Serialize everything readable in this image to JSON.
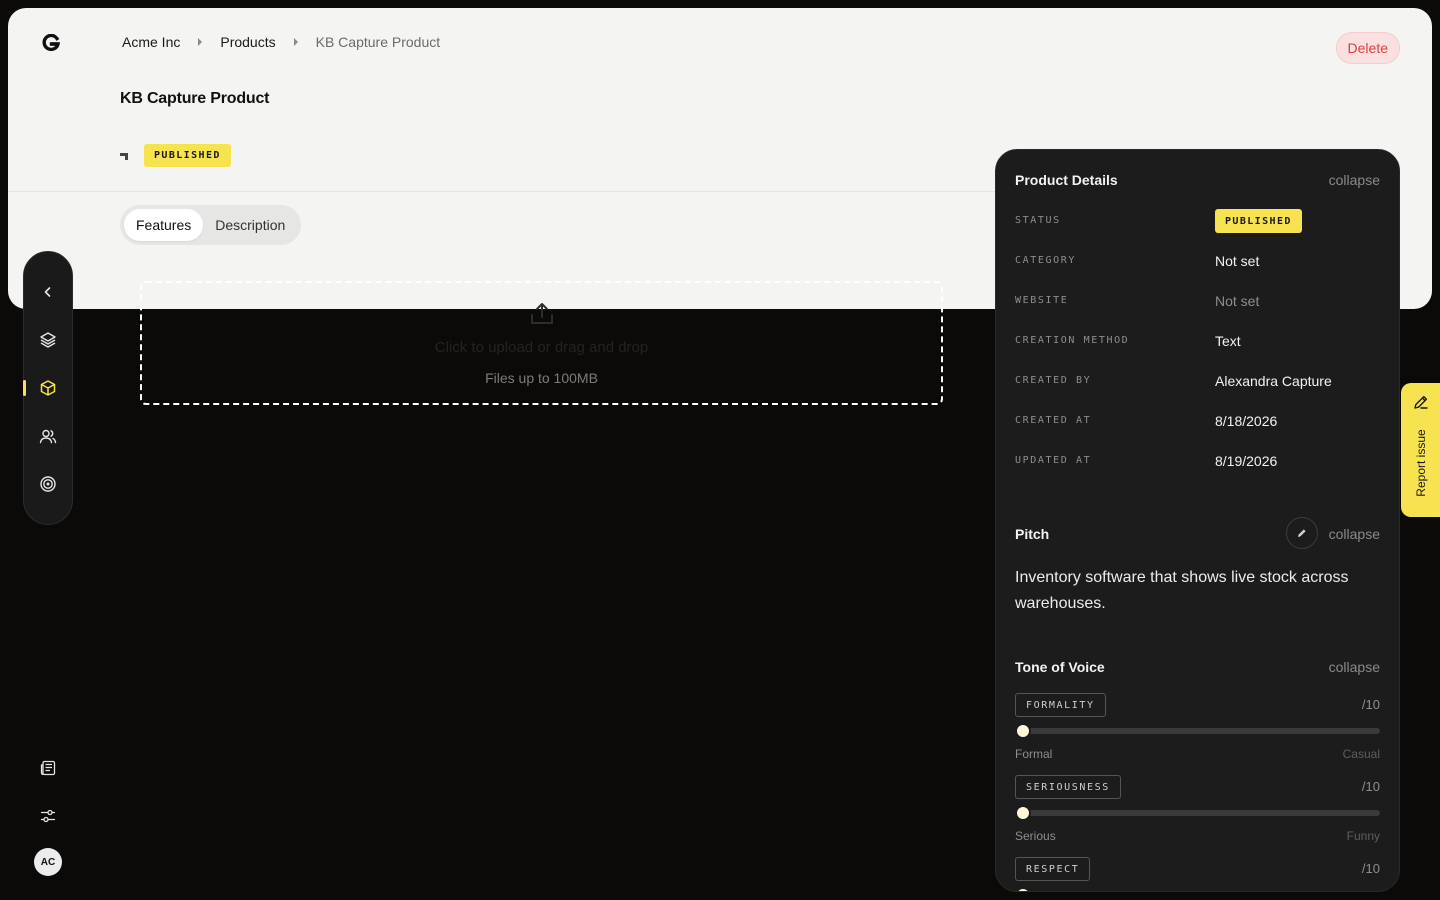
{
  "breadcrumb": {
    "items": [
      "Acme Inc",
      "Products",
      "KB Capture Product"
    ]
  },
  "header": {
    "delete_label": "Delete",
    "title": "KB Capture Product",
    "status_badge": "PUBLISHED"
  },
  "tabs": [
    {
      "label": "Features",
      "active": true
    },
    {
      "label": "Description",
      "active": false
    }
  ],
  "upload": {
    "title": "Click to upload or drag and drop",
    "subtitle": "Files up to 100MB"
  },
  "sidebar": {
    "items": [
      {
        "icon": "chevron-left-icon"
      },
      {
        "icon": "layers-icon"
      },
      {
        "icon": "box-icon",
        "active": true
      },
      {
        "icon": "users-icon"
      },
      {
        "icon": "target-icon"
      }
    ],
    "bottom": [
      {
        "icon": "newspaper-icon"
      },
      {
        "icon": "sliders-icon"
      }
    ],
    "avatar_initials": "AC"
  },
  "product_details": {
    "title": "Product Details",
    "collapse_label": "collapse",
    "status_label": "STATUS",
    "status_value": "PUBLISHED",
    "fields": [
      {
        "label": "CATEGORY",
        "value": "Not set"
      },
      {
        "label": "WEBSITE",
        "value": "Not set",
        "muted": true
      },
      {
        "label": "CREATION METHOD",
        "value": "Text"
      },
      {
        "label": "CREATED BY",
        "value": "Alexandra Capture"
      },
      {
        "label": "CREATED AT",
        "value": "8/18/2026"
      },
      {
        "label": "UPDATED AT",
        "value": "8/19/2026"
      }
    ]
  },
  "pitch": {
    "title": "Pitch",
    "collapse_label": "collapse",
    "text": "Inventory software that shows live stock across warehouses."
  },
  "tone_of_voice": {
    "title": "Tone of Voice",
    "collapse_label": "collapse",
    "sliders": [
      {
        "label": "FORMALITY",
        "max_label": "/10",
        "left": "Formal",
        "right": "Casual",
        "value": 0
      },
      {
        "label": "SERIOUSNESS",
        "max_label": "/10",
        "left": "Serious",
        "right": "Funny",
        "value": 0
      },
      {
        "label": "RESPECT",
        "max_label": "/10",
        "left": "",
        "right": "",
        "value": 0
      }
    ]
  },
  "report_issue": {
    "label": "Report issue"
  },
  "colors": {
    "accent": "#f7e34f",
    "danger": "#d94141",
    "panel_bg": "#1c1c1c",
    "page_bg": "#0c0a09"
  }
}
